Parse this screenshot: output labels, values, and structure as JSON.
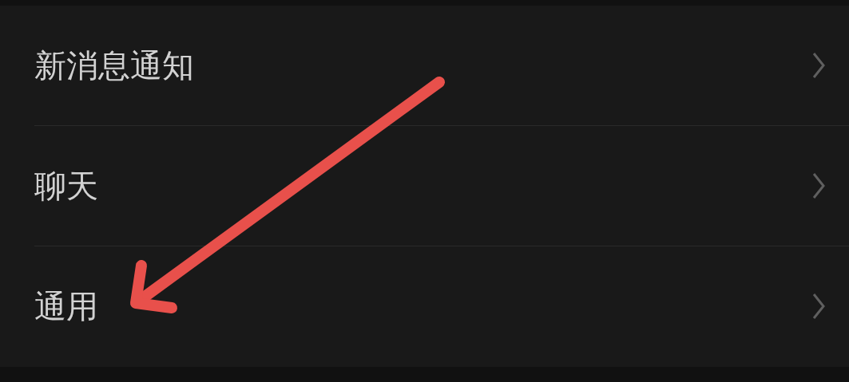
{
  "settings_list": [
    {
      "label": "新消息通知"
    },
    {
      "label": "聊天"
    },
    {
      "label": "通用"
    }
  ]
}
